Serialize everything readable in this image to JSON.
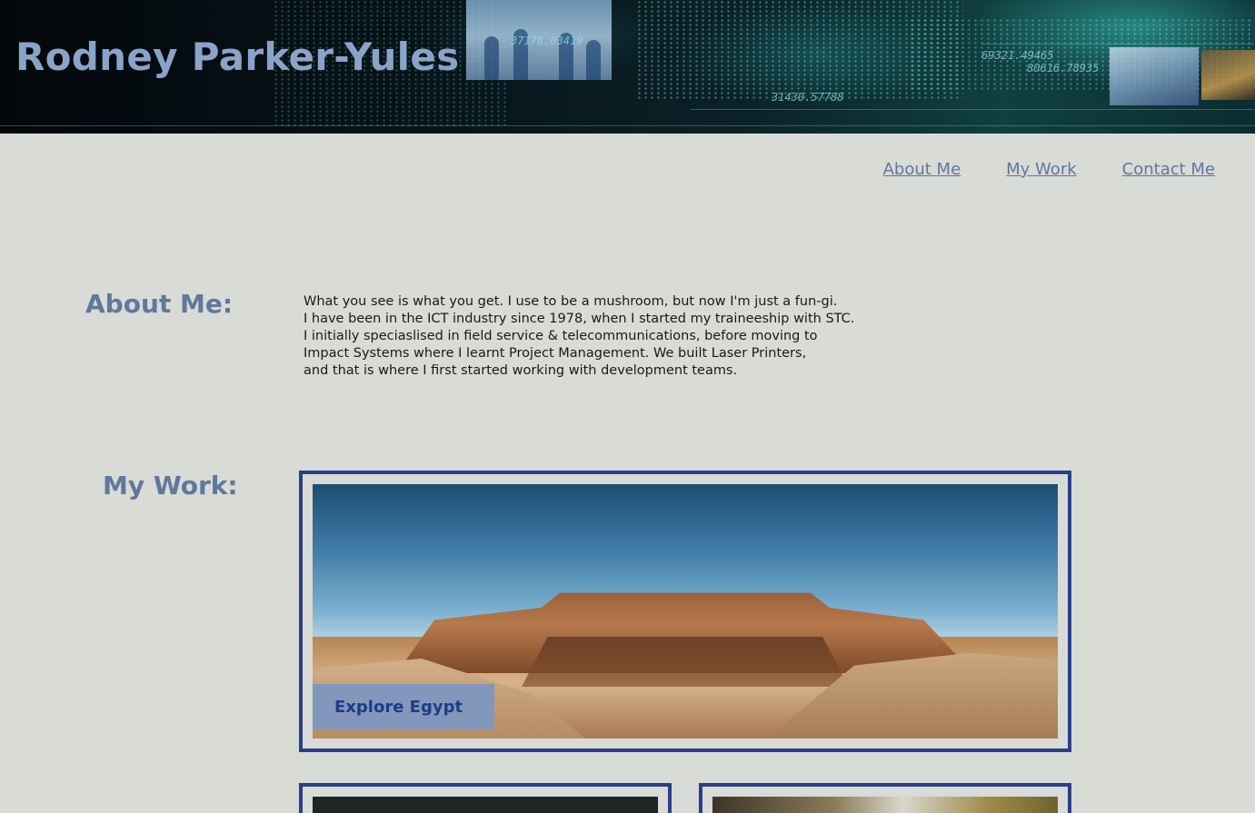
{
  "site": {
    "title": "Rodney Parker-Yules"
  },
  "banner": {
    "numbers": [
      "37178.03419",
      "69321.49465",
      "80616.78935",
      "31430.57788"
    ]
  },
  "nav": {
    "items": [
      {
        "label": "About Me"
      },
      {
        "label": "My Work"
      },
      {
        "label": "Contact Me"
      }
    ]
  },
  "about": {
    "heading": "About Me:",
    "lines": [
      "What you see is what you get. I use to be a mushroom, but now I'm just a fun-gi.",
      "I have been in the ICT industry since 1978, when I started my traineeship with STC.",
      "I initially speciaslised in field service & telecommunications, before moving to",
      "Impact Systems where I learnt Project Management. We built Laser Printers,",
      "and that is where I first started working with development teams."
    ]
  },
  "work": {
    "heading": "My Work:",
    "projects": [
      {
        "button_label": "Explore Egypt"
      }
    ]
  },
  "colors": {
    "background": "#d8dbd6",
    "accent": "#60789c",
    "card_border": "#283f8a",
    "button_bg": "#8297bb",
    "button_text": "#1e3b86"
  }
}
